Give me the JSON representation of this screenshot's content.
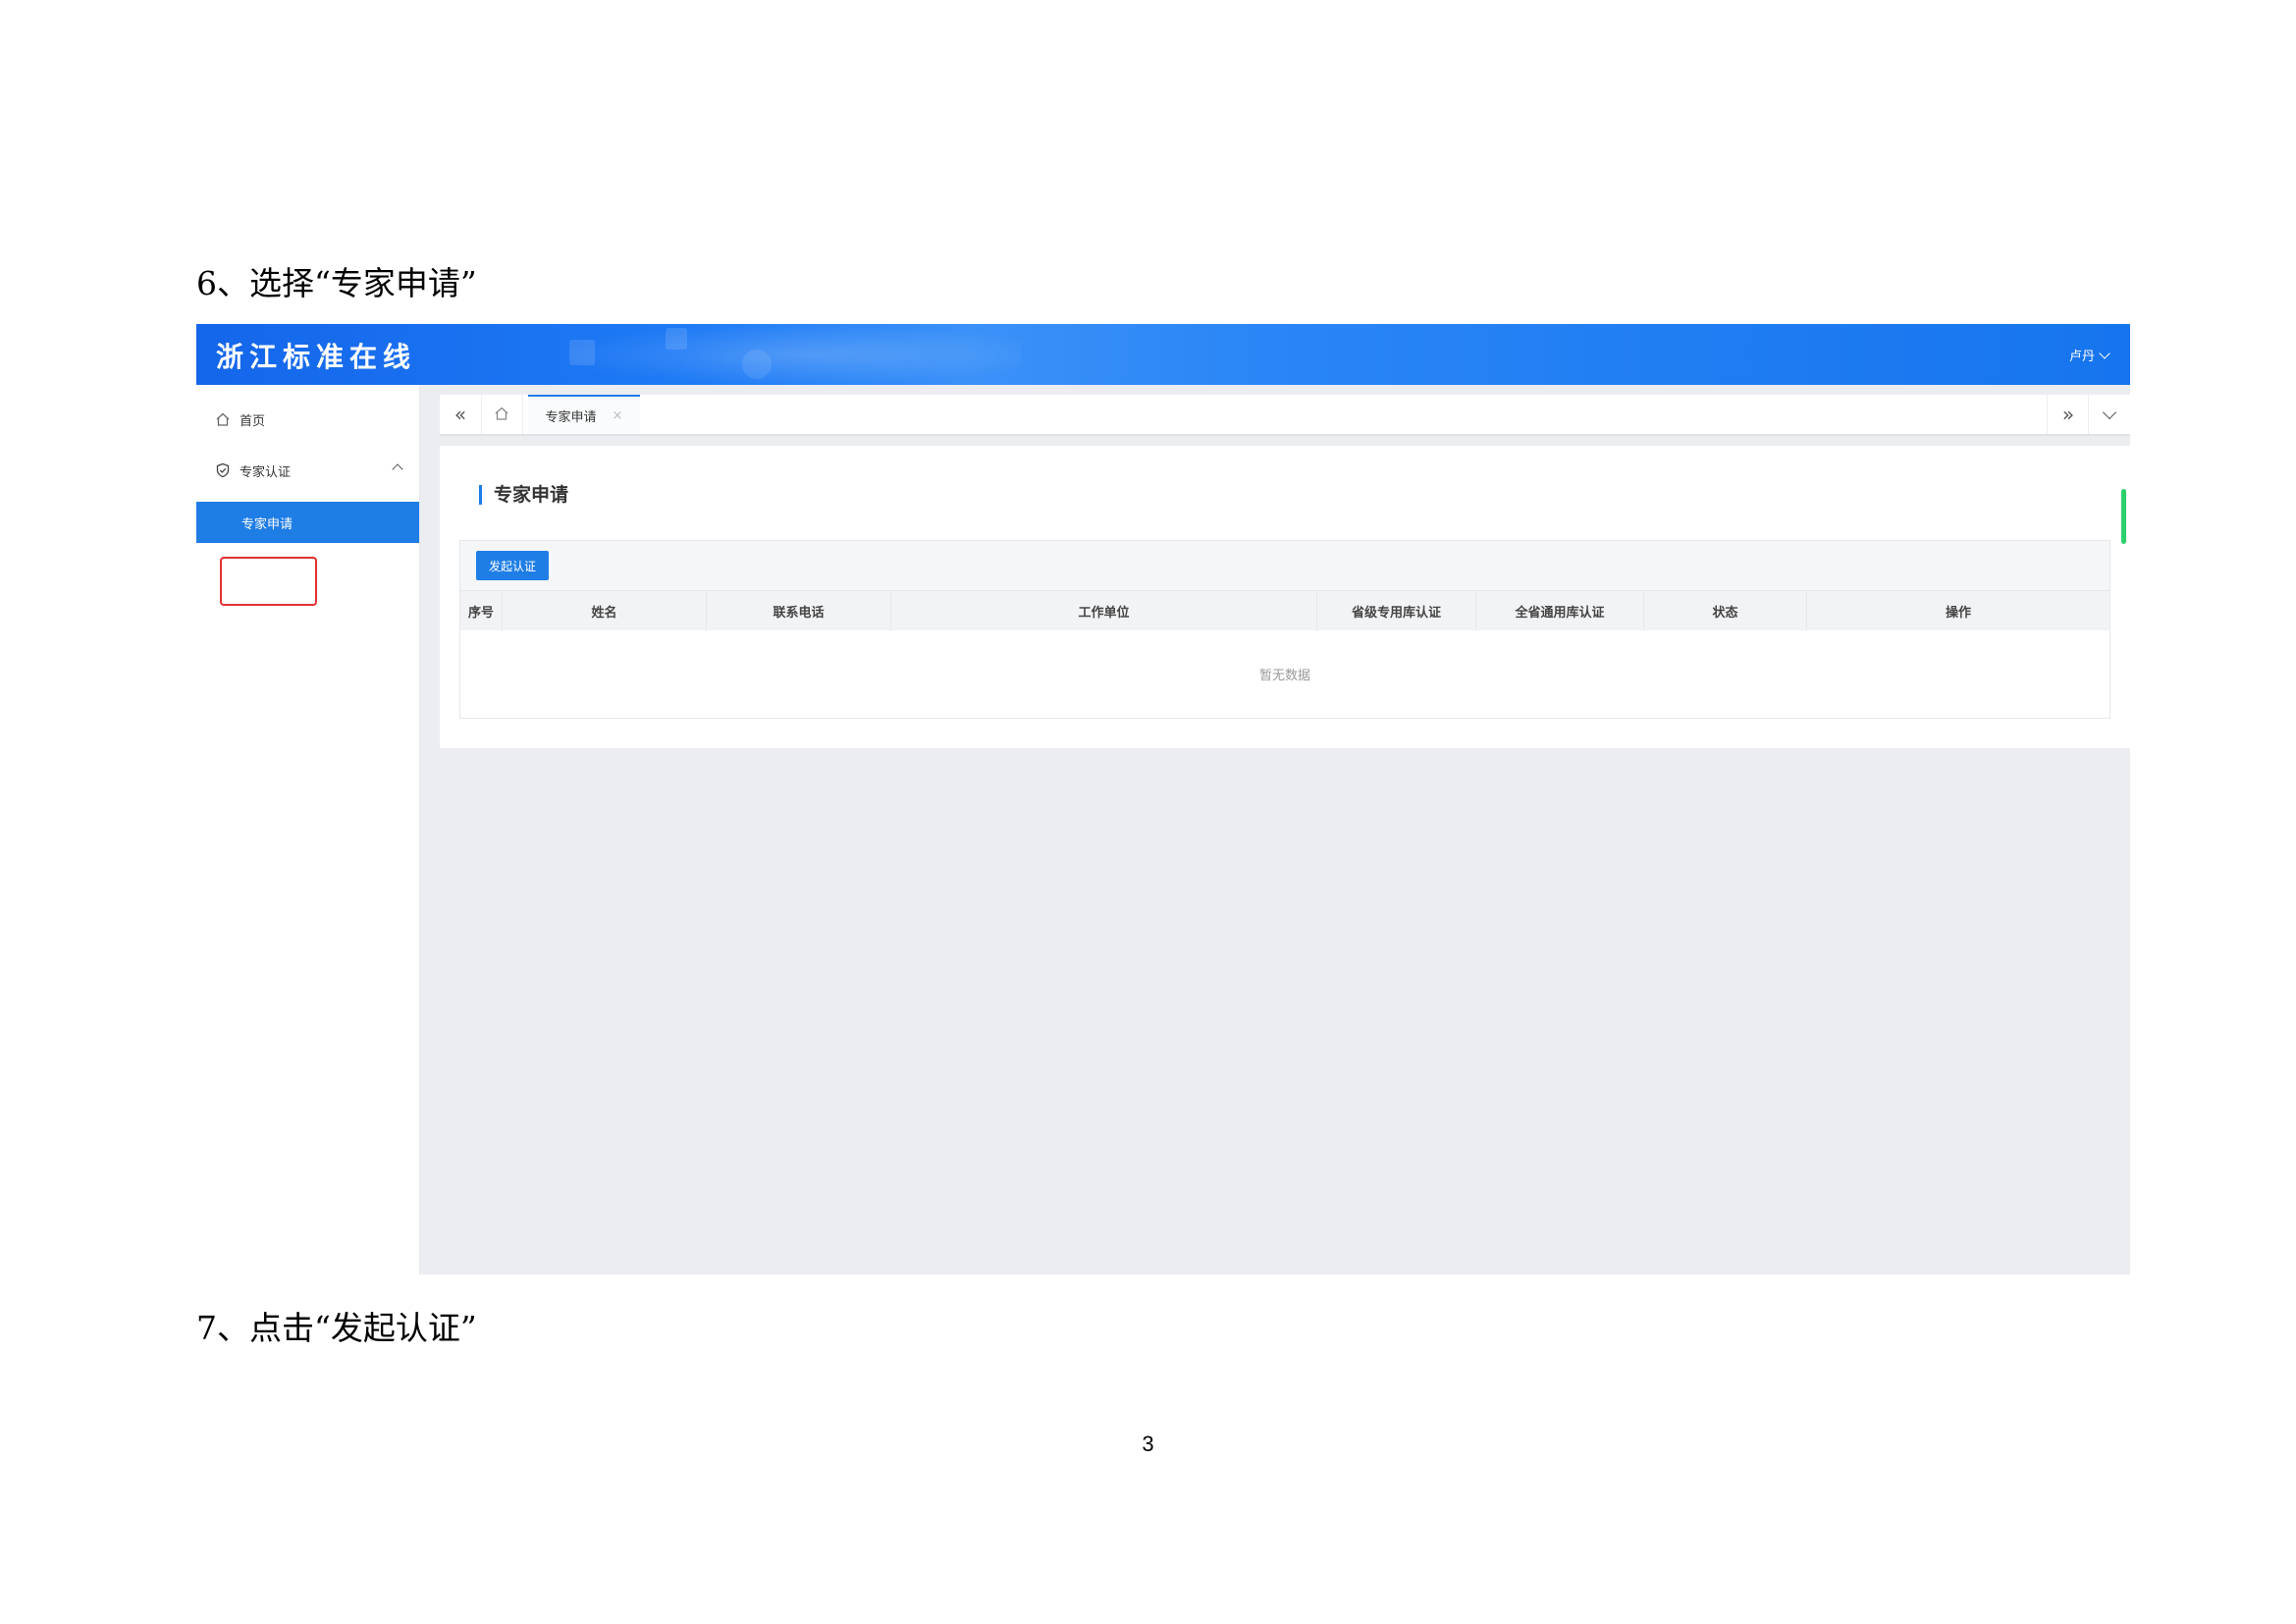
{
  "doc": {
    "step6": "6、选择“专家申请”",
    "step7": "7、点击“发起认证”",
    "page_number": "3"
  },
  "header": {
    "logo": "浙江标准在线",
    "user": "卢丹"
  },
  "sidebar": {
    "items": [
      {
        "label": "首页",
        "icon": "home-icon"
      },
      {
        "label": "专家认证",
        "icon": "shield-check-icon"
      },
      {
        "label": "专家申请"
      }
    ]
  },
  "tabs": {
    "active_label": "专家申请",
    "close_glyph": "×"
  },
  "content": {
    "title": "专家申请",
    "start_button": "发起认证",
    "columns": [
      "序号",
      "姓名",
      "联系电话",
      "工作单位",
      "省级专用库认证",
      "全省通用库认证",
      "状态",
      "操作"
    ],
    "empty_text": "暂无数据"
  },
  "colors": {
    "brand_blue": "#1f7de6",
    "highlight_red": "#e23030",
    "scroll_green": "#2bd16b"
  }
}
